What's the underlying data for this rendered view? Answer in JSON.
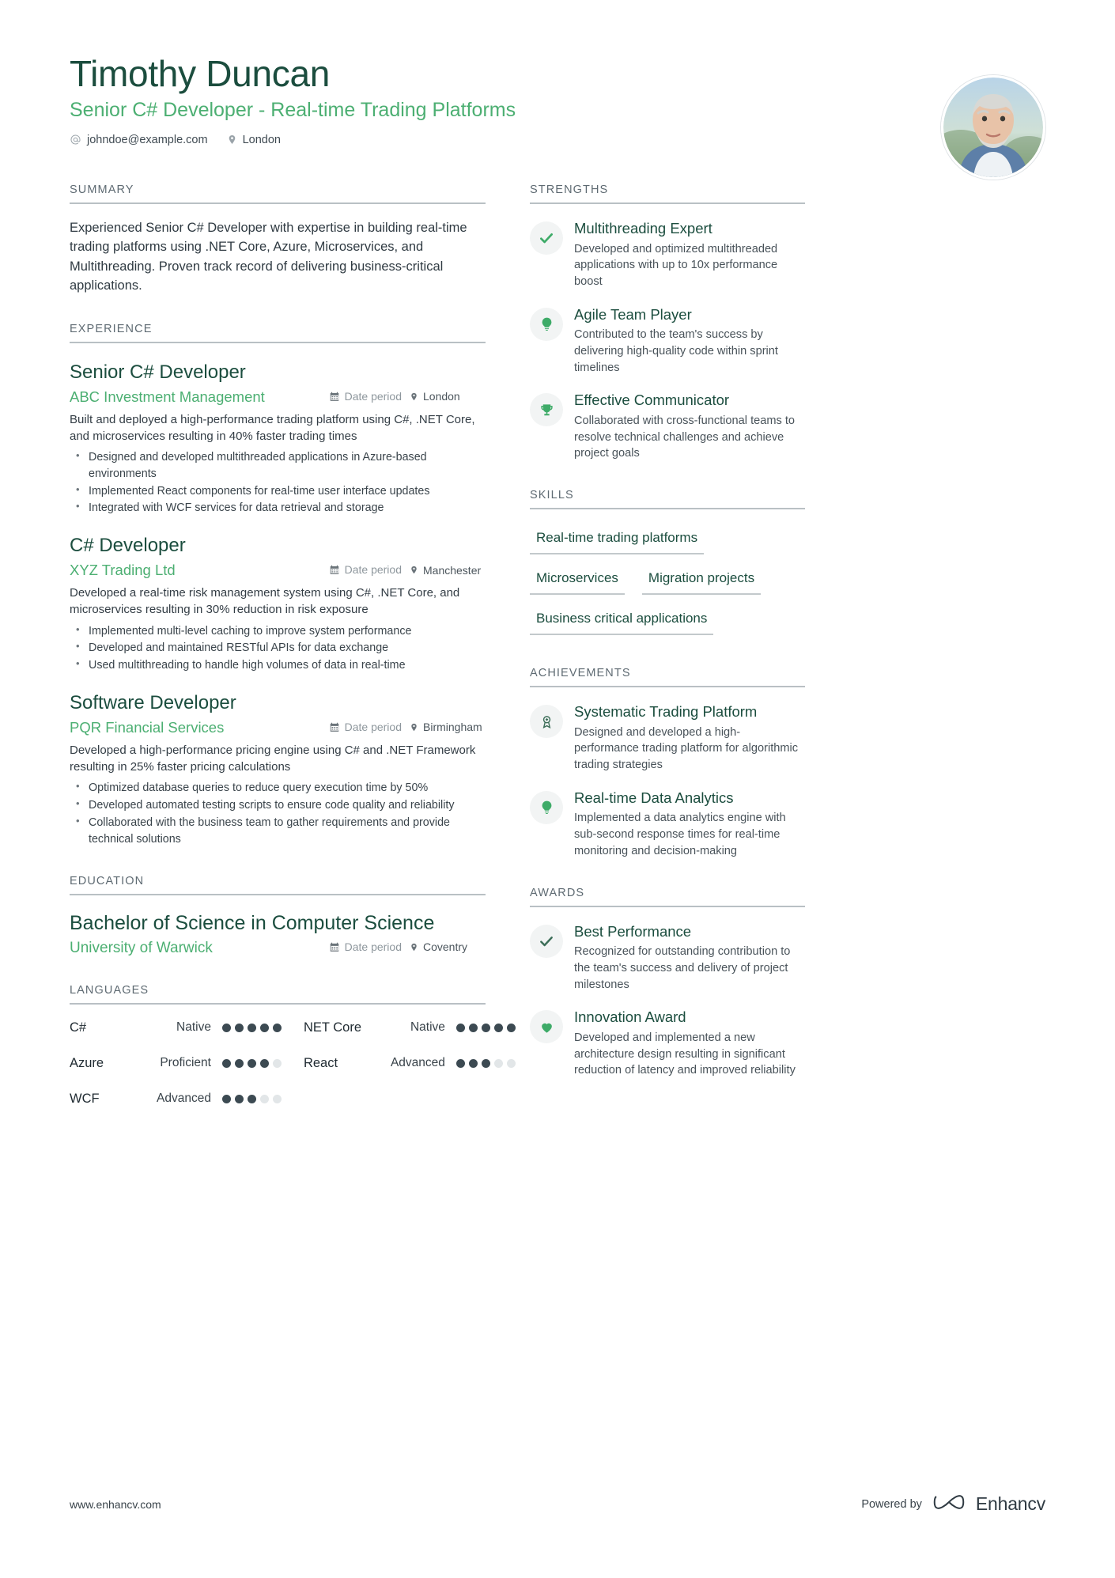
{
  "header": {
    "name": "Timothy Duncan",
    "headline": "Senior C# Developer - Real-time Trading Platforms",
    "email": "johndoe@example.com",
    "location": "London"
  },
  "summary": {
    "heading": "SUMMARY",
    "text": "Experienced Senior C# Developer with expertise in building real-time trading platforms using .NET Core, Azure, Microservices, and Multithreading. Proven track record of delivering business-critical applications."
  },
  "experience": {
    "heading": "EXPERIENCE",
    "jobs": [
      {
        "title": "Senior C# Developer",
        "company": "ABC Investment Management",
        "date": "Date period",
        "location": "London",
        "description": "Built and deployed a high-performance trading platform using C#, .NET Core, and microservices resulting in 40% faster trading times",
        "bullets": [
          "Designed and developed multithreaded applications in Azure-based environments",
          "Implemented React components for real-time user interface updates",
          "Integrated with WCF services for data retrieval and storage"
        ]
      },
      {
        "title": "C# Developer",
        "company": "XYZ Trading Ltd",
        "date": "Date period",
        "location": "Manchester",
        "description": "Developed a real-time risk management system using C#, .NET Core, and microservices resulting in 30% reduction in risk exposure",
        "bullets": [
          "Implemented multi-level caching to improve system performance",
          "Developed and maintained RESTful APIs for data exchange",
          "Used multithreading to handle high volumes of data in real-time"
        ]
      },
      {
        "title": "Software Developer",
        "company": "PQR Financial Services",
        "date": "Date period",
        "location": "Birmingham",
        "description": "Developed a high-performance pricing engine using C# and .NET Framework resulting in 25% faster pricing calculations",
        "bullets": [
          "Optimized database queries to reduce query execution time by 50%",
          "Developed automated testing scripts to ensure code quality and reliability",
          "Collaborated with the business team to gather requirements and provide technical solutions"
        ]
      }
    ]
  },
  "education": {
    "heading": "EDUCATION",
    "degree": "Bachelor of Science in Computer Science",
    "school": "University of Warwick",
    "date": "Date period",
    "location": "Coventry"
  },
  "languages": {
    "heading": "LANGUAGES",
    "items": [
      {
        "name": "C#",
        "level": "Native",
        "rating": 5,
        "max": 5
      },
      {
        "name": "NET Core",
        "level": "Native",
        "rating": 5,
        "max": 5
      },
      {
        "name": "Azure",
        "level": "Proficient",
        "rating": 4,
        "max": 5
      },
      {
        "name": "React",
        "level": "Advanced",
        "rating": 3,
        "max": 5
      },
      {
        "name": "WCF",
        "level": "Advanced",
        "rating": 3,
        "max": 5
      }
    ]
  },
  "strengths": {
    "heading": "STRENGTHS",
    "items": [
      {
        "icon": "check-icon",
        "title": "Multithreading Expert",
        "desc": "Developed and optimized multithreaded applications with up to 10x performance boost"
      },
      {
        "icon": "lightbulb-icon",
        "title": "Agile Team Player",
        "desc": "Contributed to the team's success by delivering high-quality code within sprint timelines"
      },
      {
        "icon": "trophy-icon",
        "title": "Effective Communicator",
        "desc": "Collaborated with cross-functional teams to resolve technical challenges and achieve project goals"
      }
    ]
  },
  "skills": {
    "heading": "SKILLS",
    "tags": [
      "Real-time trading platforms",
      "Microservices",
      "Migration projects",
      "Business critical applications"
    ]
  },
  "achievements": {
    "heading": "ACHIEVEMENTS",
    "items": [
      {
        "icon": "award-ribbon-icon",
        "title": "Systematic Trading Platform",
        "desc": "Designed and developed a high-performance trading platform for algorithmic trading strategies"
      },
      {
        "icon": "lightbulb-icon",
        "title": "Real-time Data Analytics",
        "desc": "Implemented a data analytics engine with sub-second response times for real-time monitoring and decision-making"
      }
    ]
  },
  "awards": {
    "heading": "AWARDS",
    "items": [
      {
        "icon": "check-icon",
        "title": "Best Performance",
        "desc": "Recognized for outstanding contribution to the team's success and delivery of project milestones"
      },
      {
        "icon": "heart-icon",
        "title": "Innovation Award",
        "desc": "Developed and implemented a new architecture design resulting in significant reduction of latency and improved reliability"
      }
    ]
  },
  "footer": {
    "site": "www.enhancv.com",
    "powered_by": "Powered by",
    "brand": "Enhancv"
  },
  "colors": {
    "dark_green": "#1b4d3e",
    "accent_green": "#4caf72",
    "rule_gray": "#b9c0c4",
    "body_text": "#333d45"
  }
}
